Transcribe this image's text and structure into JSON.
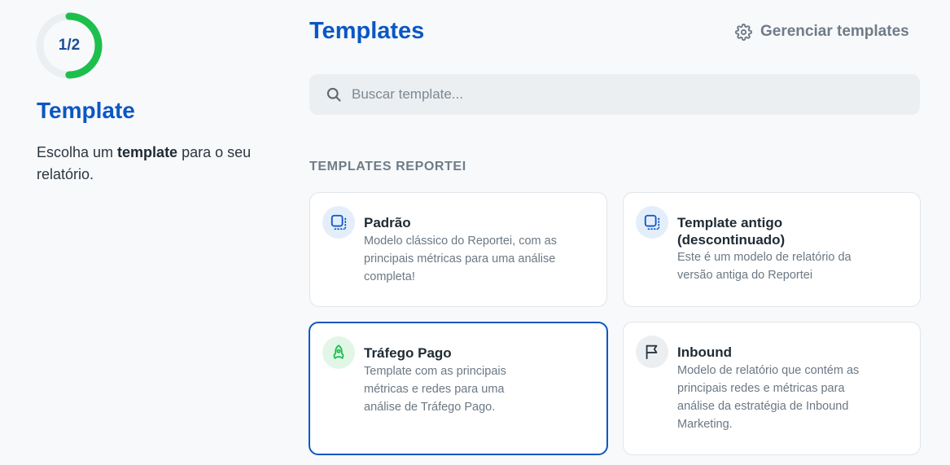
{
  "step": {
    "progress_label": "1/2",
    "progress_fraction": 0.5,
    "title": "Template",
    "desc_prefix": "Escolha um ",
    "desc_bold": "template",
    "desc_suffix": " para o seu relatório."
  },
  "header": {
    "title": "Templates",
    "manage_label": "Gerenciar templates"
  },
  "search": {
    "placeholder": "Buscar template...",
    "value": ""
  },
  "section": {
    "label": "TEMPLATES REPORTEI"
  },
  "templates": [
    {
      "title": "Padrão",
      "description": "Modelo clássico do Reportei, com as principais métricas para uma análise completa!",
      "icon": "layout-icon",
      "selected": false
    },
    {
      "title": "Template antigo (descontinuado)",
      "description": "Este é um modelo de relatório da versão antiga do Reportei",
      "icon": "layout-icon",
      "selected": false
    },
    {
      "title": "Tráfego Pago",
      "description": "Template com as principais métricas e redes para uma análise de Tráfego Pago.",
      "icon": "rocket-icon",
      "selected": true
    },
    {
      "title": "Inbound",
      "description": "Modelo de relatório que contém as principais redes e métricas para análise da estratégia de Inbound Marketing.",
      "icon": "flag-icon",
      "selected": false
    }
  ],
  "colors": {
    "primary": "#0b57c4",
    "progress": "#1cbf4c",
    "muted": "#6f7c88"
  }
}
